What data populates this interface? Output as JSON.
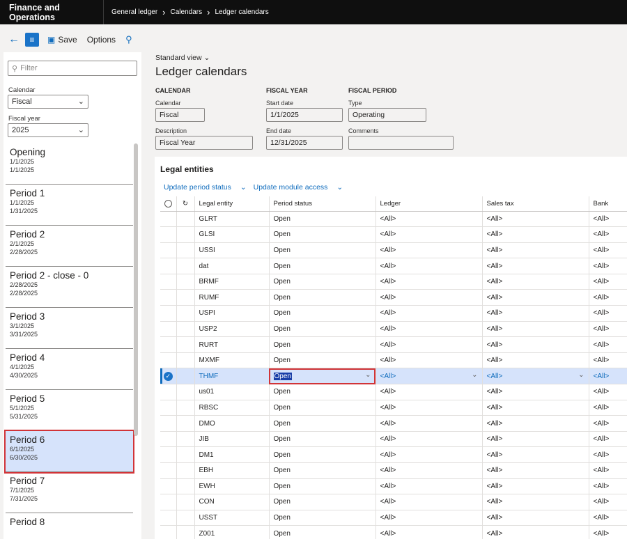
{
  "topbar": {
    "app_name": "Finance and Operations",
    "breadcrumb": [
      "General ledger",
      "Calendars",
      "Ledger calendars"
    ]
  },
  "actionbar": {
    "save_label": "Save",
    "options_label": "Options"
  },
  "leftpane": {
    "filter_placeholder": "Filter",
    "calendar_label": "Calendar",
    "calendar_value": "Fiscal",
    "fiscal_year_label": "Fiscal year",
    "fiscal_year_value": "2025",
    "periods": [
      {
        "name": "Opening",
        "start": "1/1/2025",
        "end": "1/1/2025"
      },
      {
        "name": "Period 1",
        "start": "1/1/2025",
        "end": "1/31/2025"
      },
      {
        "name": "Period 2",
        "start": "2/1/2025",
        "end": "2/28/2025"
      },
      {
        "name": "Period 2 - close - 0",
        "start": "2/28/2025",
        "end": "2/28/2025"
      },
      {
        "name": "Period 3",
        "start": "3/1/2025",
        "end": "3/31/2025"
      },
      {
        "name": "Period 4",
        "start": "4/1/2025",
        "end": "4/30/2025"
      },
      {
        "name": "Period 5",
        "start": "5/1/2025",
        "end": "5/31/2025"
      },
      {
        "name": "Period 6",
        "start": "6/1/2025",
        "end": "6/30/2025"
      },
      {
        "name": "Period 7",
        "start": "7/1/2025",
        "end": "7/31/2025"
      },
      {
        "name": "Period 8",
        "start": "",
        "end": ""
      }
    ],
    "selected_period": "Period 6"
  },
  "main": {
    "view_selector": "Standard view",
    "page_title": "Ledger calendars",
    "calendar_group": {
      "heading": "CALENDAR",
      "calendar_label": "Calendar",
      "calendar_value": "Fiscal",
      "description_label": "Description",
      "description_value": "Fiscal Year"
    },
    "fiscal_year_group": {
      "heading": "FISCAL YEAR",
      "start_label": "Start date",
      "start_value": "1/1/2025",
      "end_label": "End date",
      "end_value": "12/31/2025"
    },
    "fiscal_period_group": {
      "heading": "FISCAL PERIOD",
      "type_label": "Type",
      "type_value": "Operating",
      "comments_label": "Comments",
      "comments_value": ""
    },
    "legal_entities": {
      "title": "Legal entities",
      "actions": [
        "Update period status",
        "Update module access"
      ],
      "columns": [
        "Legal entity",
        "Period status",
        "Ledger",
        "Sales tax",
        "Bank"
      ],
      "rows": [
        [
          "GLRT",
          "Open",
          "<All>",
          "<All>",
          "<All>"
        ],
        [
          "GLSI",
          "Open",
          "<All>",
          "<All>",
          "<All>"
        ],
        [
          "USSI",
          "Open",
          "<All>",
          "<All>",
          "<All>"
        ],
        [
          "dat",
          "Open",
          "<All>",
          "<All>",
          "<All>"
        ],
        [
          "BRMF",
          "Open",
          "<All>",
          "<All>",
          "<All>"
        ],
        [
          "RUMF",
          "Open",
          "<All>",
          "<All>",
          "<All>"
        ],
        [
          "USPI",
          "Open",
          "<All>",
          "<All>",
          "<All>"
        ],
        [
          "USP2",
          "Open",
          "<All>",
          "<All>",
          "<All>"
        ],
        [
          "RURT",
          "Open",
          "<All>",
          "<All>",
          "<All>"
        ],
        [
          "MXMF",
          "Open",
          "<All>",
          "<All>",
          "<All>"
        ],
        [
          "THMF",
          "Open",
          "<All>",
          "<All>",
          "<All>"
        ],
        [
          "us01",
          "Open",
          "<All>",
          "<All>",
          "<All>"
        ],
        [
          "RBSC",
          "Open",
          "<All>",
          "<All>",
          "<All>"
        ],
        [
          "DMO",
          "Open",
          "<All>",
          "<All>",
          "<All>"
        ],
        [
          "JIB",
          "Open",
          "<All>",
          "<All>",
          "<All>"
        ],
        [
          "DM1",
          "Open",
          "<All>",
          "<All>",
          "<All>"
        ],
        [
          "EBH",
          "Open",
          "<All>",
          "<All>",
          "<All>"
        ],
        [
          "EWH",
          "Open",
          "<All>",
          "<All>",
          "<All>"
        ],
        [
          "CON",
          "Open",
          "<All>",
          "<All>",
          "<All>"
        ],
        [
          "USST",
          "Open",
          "<All>",
          "<All>",
          "<All>"
        ],
        [
          "Z001",
          "Open",
          "<All>",
          "<All>",
          "<All>"
        ]
      ],
      "active_row_index": 10
    }
  },
  "colors": {
    "accent": "#0f6cbd",
    "topbar": "#0f0f0f",
    "selection": "#d6e3fb",
    "highlight_border": "#d13438"
  }
}
